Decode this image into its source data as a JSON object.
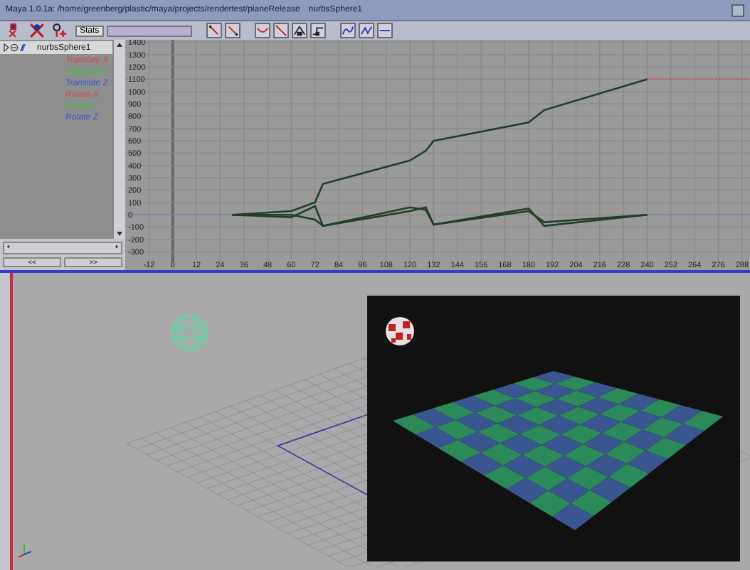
{
  "window": {
    "title": "Maya 1.0.1a: /home/greenberg/plastic/maya/projects/rendertest/planeRelease",
    "object_name": "nurbsSphere1"
  },
  "toolbar": {
    "stats_label": "Stats"
  },
  "outliner": {
    "object": "nurbsSphere1",
    "channels": [
      {
        "name": "Translate X",
        "color": "#d04848"
      },
      {
        "name": "Translate Y",
        "color": "#40c040"
      },
      {
        "name": "Translate Z",
        "color": "#4050d0"
      },
      {
        "name": "Rotate X",
        "color": "#d04848"
      },
      {
        "name": "Rotate Y",
        "color": "#40c040"
      },
      {
        "name": "Rotate Z",
        "color": "#4050d0"
      }
    ],
    "scroll_buttons": [
      "<<",
      ">>"
    ]
  },
  "graph": {
    "chart_data": {
      "type": "line",
      "xlim": [
        -24,
        292
      ],
      "ylim": [
        -380,
        1420
      ],
      "xticks": [
        -12,
        0,
        12,
        24,
        36,
        48,
        60,
        72,
        84,
        96,
        108,
        120,
        132,
        144,
        156,
        168,
        180,
        192,
        204,
        216,
        228,
        240,
        252,
        264,
        276,
        288
      ],
      "yticks": [
        -300,
        -200,
        -100,
        0,
        100,
        200,
        300,
        400,
        500,
        600,
        700,
        800,
        900,
        1000,
        1100,
        1200,
        1300,
        1400
      ],
      "grid": true,
      "x": [
        -20,
        30,
        60,
        72,
        76,
        120,
        128,
        132,
        180,
        188,
        240,
        292
      ],
      "series": [
        {
          "color": "#1f3f26",
          "values": [
            null,
            0,
            30,
            100,
            250,
            440,
            520,
            600,
            750,
            850,
            1100,
            null
          ]
        },
        {
          "color": "#1f3f26",
          "values": [
            null,
            0,
            0,
            -40,
            -90,
            30,
            60,
            -80,
            30,
            -60,
            0,
            null
          ]
        },
        {
          "color": "#1f3f26",
          "values": [
            null,
            0,
            -20,
            70,
            -90,
            60,
            40,
            -80,
            50,
            -90,
            0,
            null
          ]
        },
        {
          "color": "#d05050",
          "line_style": "dotted",
          "values": [
            null,
            null,
            null,
            null,
            null,
            null,
            null,
            null,
            null,
            null,
            1100,
            1100
          ]
        },
        {
          "color": "#6a7ad0",
          "line_style": "dotted",
          "values": [
            0,
            0,
            null,
            null,
            null,
            null,
            null,
            null,
            null,
            null,
            0,
            0
          ]
        }
      ]
    }
  }
}
